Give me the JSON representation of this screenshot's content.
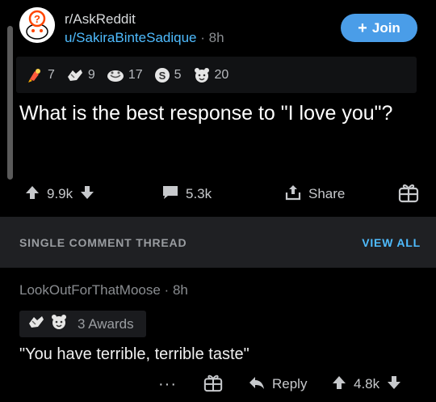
{
  "post": {
    "subreddit": "r/AskReddit",
    "author": "u/SakiraBinteSadique",
    "separator": "·",
    "age": "8h",
    "join_label": "Join",
    "awards": [
      {
        "icon": "rocket-like-award-icon",
        "count": "7"
      },
      {
        "icon": "wholesome-award-icon",
        "count": "9"
      },
      {
        "icon": "helpful-award-icon",
        "count": "17"
      },
      {
        "icon": "silver-award-icon",
        "count": "5"
      },
      {
        "icon": "bear-award-icon",
        "count": "20"
      }
    ],
    "title": "What is the best response to \"I love you\"?",
    "score": "9.9k",
    "comments": "5.3k",
    "share_label": "Share"
  },
  "thread": {
    "title": "SINGLE COMMENT THREAD",
    "view_all": "VIEW ALL"
  },
  "comment": {
    "author": "LookOutForThatMoose",
    "separator": "·",
    "age": "8h",
    "awards_label": "3 Awards",
    "body": "\"You have terrible, terrible taste\"",
    "more": "···",
    "reply_label": "Reply",
    "score": "4.8k"
  },
  "colors": {
    "accent": "#4fbcff",
    "join_bg": "#4a9de8",
    "thread_bar": "#1f2023"
  }
}
